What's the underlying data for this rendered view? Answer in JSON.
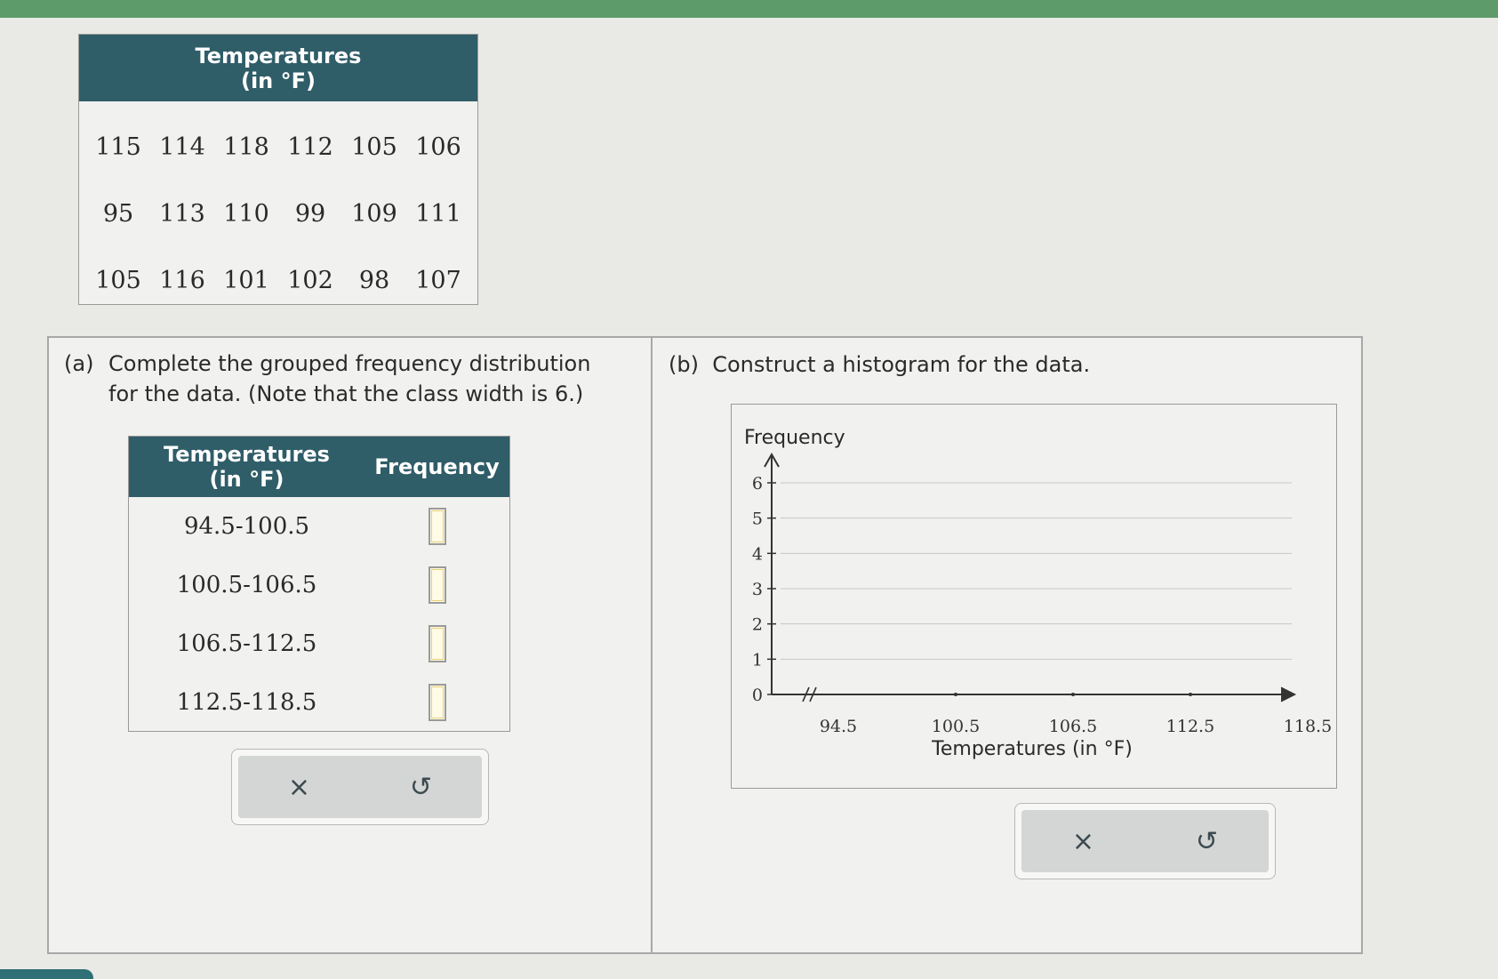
{
  "data_table": {
    "header": "Temperatures\n(in °F)",
    "rows": [
      [
        "115",
        "114",
        "118",
        "112",
        "105",
        "106"
      ],
      [
        "95",
        "113",
        "110",
        "99",
        "109",
        "111"
      ],
      [
        "105",
        "116",
        "101",
        "102",
        "98",
        "107"
      ]
    ]
  },
  "part_a": {
    "label": "(a)",
    "text": "Complete the grouped frequency distribution for the data. (Note that the class width is 6.)",
    "table": {
      "col_temp": "Temperatures\n(in °F)",
      "col_freq": "Frequency",
      "classes": [
        "94.5-100.5",
        "100.5-106.5",
        "106.5-112.5",
        "112.5-118.5"
      ],
      "frequencies": [
        "",
        "",
        "",
        ""
      ]
    }
  },
  "part_b": {
    "label": "(b)",
    "text": "Construct a histogram for the data."
  },
  "buttons": {
    "clear": "×",
    "undo": "↺"
  },
  "chart_data": {
    "type": "bar",
    "ylabel": "Frequency",
    "xlabel": "Temperatures (in °F)",
    "ylim": [
      0,
      6
    ],
    "yticks": [
      0,
      1,
      2,
      3,
      4,
      5,
      6
    ],
    "xticks": [
      "94.5",
      "100.5",
      "106.5",
      "112.5",
      "118.5"
    ],
    "categories": [
      "94.5-100.5",
      "100.5-106.5",
      "106.5-112.5",
      "112.5-118.5"
    ],
    "values": [],
    "grid": true,
    "axis_break": true
  }
}
